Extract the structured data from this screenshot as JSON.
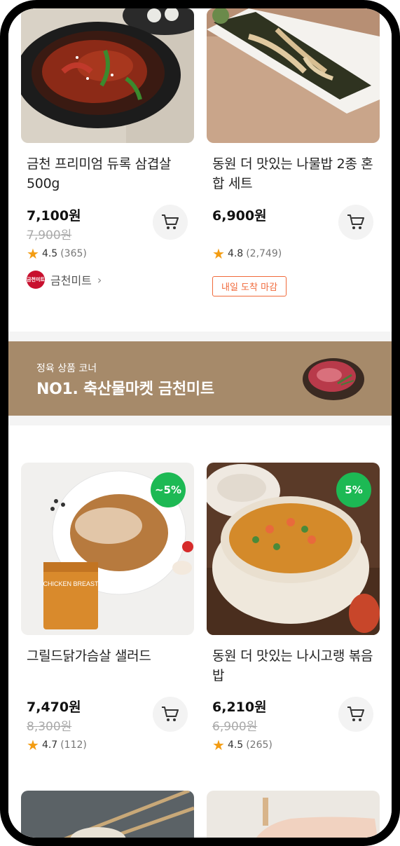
{
  "products_top": [
    {
      "name": "금천 프리미엄 듀록 삼겹살 500g",
      "price": "7,100원",
      "original_price": "7,900원",
      "rating": "4.5",
      "review_count": "(365)",
      "seller": "금천미트",
      "seller_logo_text": "금천미트"
    },
    {
      "name": "동원 더 맛있는 나물밥 2종 혼합 세트",
      "price": "6,900원",
      "rating": "4.8",
      "review_count": "(2,749)",
      "tag": "내일 도착 마감"
    }
  ],
  "banner": {
    "subtitle": "정육 상품 코너",
    "title": "NO1. 축산물마켓 금천미트"
  },
  "products_bottom": [
    {
      "name": "그릴드닭가슴살 샐러드",
      "price": "7,470원",
      "original_price": "8,300원",
      "rating": "4.7",
      "review_count": "(112)",
      "discount_badge": "~5%",
      "package_text": "CHICKEN BREAST"
    },
    {
      "name": "동원 더 맛있는 나시고랭 볶음밥",
      "price": "6,210원",
      "original_price": "6,900원",
      "rating": "4.5",
      "review_count": "(265)",
      "discount_badge": "5%"
    }
  ],
  "colors": {
    "accent_green": "#1db954",
    "star": "#f39c12",
    "tag_orange": "#f06a3b",
    "banner_bg": "#a68a6a"
  },
  "icons": {
    "cart": "cart-icon",
    "star": "star-icon",
    "chevron": "chevron-right-icon"
  }
}
